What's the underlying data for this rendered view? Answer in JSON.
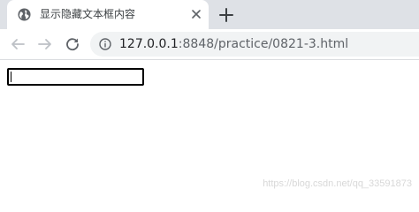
{
  "tab": {
    "title": "显示隐藏文本框内容",
    "favicon": "globe-icon",
    "close_icon": "close-icon"
  },
  "new_tab_icon": "plus-icon",
  "toolbar": {
    "back_icon": "arrow-left-icon",
    "forward_icon": "arrow-right-icon",
    "reload_icon": "reload-icon",
    "site_info_icon": "info-icon",
    "url_host": "127.0.0.1",
    "url_rest": ":8848/practice/0821-3.html"
  },
  "page": {
    "input_value": "",
    "input_focused": true
  },
  "watermark": "https://blog.csdn.net/qq_33591873",
  "colors": {
    "tab_strip": "#dee1e6",
    "omnibox": "#f1f3f4",
    "input_border": "#000000"
  }
}
